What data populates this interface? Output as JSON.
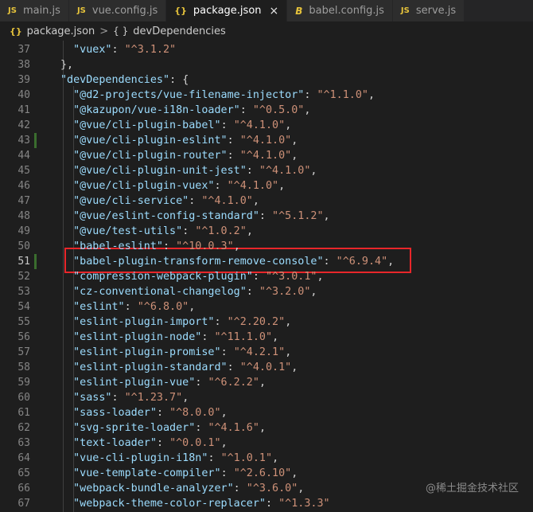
{
  "tabs": [
    {
      "icon": "JS",
      "label": "main.js"
    },
    {
      "icon": "JS",
      "label": "vue.config.js"
    },
    {
      "icon": "{}",
      "label": "package.json"
    },
    {
      "icon": "B",
      "label": "babel.config.js"
    },
    {
      "icon": "JS",
      "label": "serve.js"
    }
  ],
  "active_tab": "package.json",
  "tab_close_glyph": "×",
  "breadcrumb": {
    "file_icon": "{}",
    "file": "package.json",
    "separator": ">",
    "object_icon": "{ }",
    "object": "devDependencies"
  },
  "lines": [
    {
      "n": "37",
      "indent": 2,
      "key": "\"vuex\"",
      "sep": ": ",
      "val": "\"^3.1.2\"",
      "tail": ""
    },
    {
      "n": "38",
      "indent": 1,
      "key": "",
      "sep": "",
      "val": "",
      "tail": "},"
    },
    {
      "n": "39",
      "indent": 1,
      "key": "\"devDependencies\"",
      "sep": ": ",
      "val": "",
      "tail": "{"
    },
    {
      "n": "40",
      "indent": 2,
      "key": "\"@d2-projects/vue-filename-injector\"",
      "sep": ": ",
      "val": "\"^1.1.0\"",
      "tail": ","
    },
    {
      "n": "41",
      "indent": 2,
      "key": "\"@kazupon/vue-i18n-loader\"",
      "sep": ": ",
      "val": "\"^0.5.0\"",
      "tail": ","
    },
    {
      "n": "42",
      "indent": 2,
      "key": "\"@vue/cli-plugin-babel\"",
      "sep": ": ",
      "val": "\"^4.1.0\"",
      "tail": ","
    },
    {
      "n": "43",
      "indent": 2,
      "key": "\"@vue/cli-plugin-eslint\"",
      "sep": ": ",
      "val": "\"^4.1.0\"",
      "tail": ","
    },
    {
      "n": "44",
      "indent": 2,
      "key": "\"@vue/cli-plugin-router\"",
      "sep": ": ",
      "val": "\"^4.1.0\"",
      "tail": ","
    },
    {
      "n": "45",
      "indent": 2,
      "key": "\"@vue/cli-plugin-unit-jest\"",
      "sep": ": ",
      "val": "\"^4.1.0\"",
      "tail": ","
    },
    {
      "n": "46",
      "indent": 2,
      "key": "\"@vue/cli-plugin-vuex\"",
      "sep": ": ",
      "val": "\"^4.1.0\"",
      "tail": ","
    },
    {
      "n": "47",
      "indent": 2,
      "key": "\"@vue/cli-service\"",
      "sep": ": ",
      "val": "\"^4.1.0\"",
      "tail": ","
    },
    {
      "n": "48",
      "indent": 2,
      "key": "\"@vue/eslint-config-standard\"",
      "sep": ": ",
      "val": "\"^5.1.2\"",
      "tail": ","
    },
    {
      "n": "49",
      "indent": 2,
      "key": "\"@vue/test-utils\"",
      "sep": ": ",
      "val": "\"^1.0.2\"",
      "tail": ","
    },
    {
      "n": "50",
      "indent": 2,
      "key": "\"babel-eslint\"",
      "sep": ": ",
      "val": "\"^10.0.3\"",
      "tail": ","
    },
    {
      "n": "51",
      "indent": 2,
      "key": "\"babel-plugin-transform-remove-console\"",
      "sep": ": ",
      "val": "\"^6.9.4\"",
      "tail": ","
    },
    {
      "n": "52",
      "indent": 2,
      "key": "\"compression-webpack-plugin\"",
      "sep": ": ",
      "val": "\"^3.0.1\"",
      "tail": ","
    },
    {
      "n": "53",
      "indent": 2,
      "key": "\"cz-conventional-changelog\"",
      "sep": ": ",
      "val": "\"^3.2.0\"",
      "tail": ","
    },
    {
      "n": "54",
      "indent": 2,
      "key": "\"eslint\"",
      "sep": ": ",
      "val": "\"^6.8.0\"",
      "tail": ","
    },
    {
      "n": "55",
      "indent": 2,
      "key": "\"eslint-plugin-import\"",
      "sep": ": ",
      "val": "\"^2.20.2\"",
      "tail": ","
    },
    {
      "n": "56",
      "indent": 2,
      "key": "\"eslint-plugin-node\"",
      "sep": ": ",
      "val": "\"^11.1.0\"",
      "tail": ","
    },
    {
      "n": "57",
      "indent": 2,
      "key": "\"eslint-plugin-promise\"",
      "sep": ": ",
      "val": "\"^4.2.1\"",
      "tail": ","
    },
    {
      "n": "58",
      "indent": 2,
      "key": "\"eslint-plugin-standard\"",
      "sep": ": ",
      "val": "\"^4.0.1\"",
      "tail": ","
    },
    {
      "n": "59",
      "indent": 2,
      "key": "\"eslint-plugin-vue\"",
      "sep": ": ",
      "val": "\"^6.2.2\"",
      "tail": ","
    },
    {
      "n": "60",
      "indent": 2,
      "key": "\"sass\"",
      "sep": ": ",
      "val": "\"^1.23.7\"",
      "tail": ","
    },
    {
      "n": "61",
      "indent": 2,
      "key": "\"sass-loader\"",
      "sep": ": ",
      "val": "\"^8.0.0\"",
      "tail": ","
    },
    {
      "n": "62",
      "indent": 2,
      "key": "\"svg-sprite-loader\"",
      "sep": ": ",
      "val": "\"^4.1.6\"",
      "tail": ","
    },
    {
      "n": "63",
      "indent": 2,
      "key": "\"text-loader\"",
      "sep": ": ",
      "val": "\"^0.0.1\"",
      "tail": ","
    },
    {
      "n": "64",
      "indent": 2,
      "key": "\"vue-cli-plugin-i18n\"",
      "sep": ": ",
      "val": "\"^1.0.1\"",
      "tail": ","
    },
    {
      "n": "65",
      "indent": 2,
      "key": "\"vue-template-compiler\"",
      "sep": ": ",
      "val": "\"^2.6.10\"",
      "tail": ","
    },
    {
      "n": "66",
      "indent": 2,
      "key": "\"webpack-bundle-analyzer\"",
      "sep": ": ",
      "val": "\"^3.6.0\"",
      "tail": ","
    },
    {
      "n": "67",
      "indent": 2,
      "key": "\"webpack-theme-color-replacer\"",
      "sep": ": ",
      "val": "\"^1.3.3\"",
      "tail": ""
    }
  ],
  "active_line": "51",
  "highlighted_line": "51",
  "modified_lines": [
    "43",
    "51"
  ],
  "watermark": "@稀土掘金技术社区",
  "colors": {
    "background": "#1e1e1e",
    "json_key": "#9cdcfe",
    "json_string": "#ce9178",
    "highlight_border": "#e8262a",
    "js_icon": "#e5c23b"
  }
}
